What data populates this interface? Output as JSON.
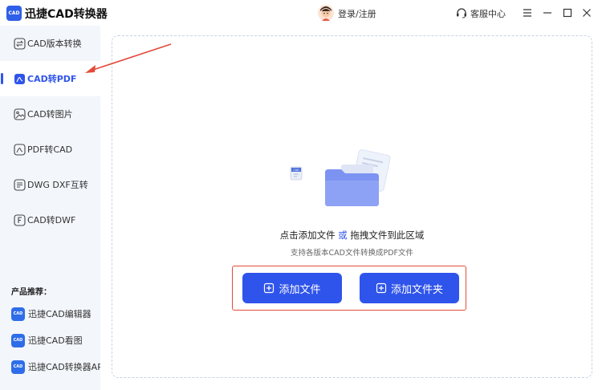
{
  "app": {
    "logo_text": "CAD",
    "title": "迅捷CAD转换器"
  },
  "header": {
    "login": "登录/注册",
    "service": "客服中心"
  },
  "sidebar": {
    "items": [
      {
        "label": "CAD版本转换",
        "icon": "version-convert-icon"
      },
      {
        "label": "CAD转PDF",
        "icon": "pdf-icon",
        "active": true
      },
      {
        "label": "CAD转图片",
        "icon": "image-icon"
      },
      {
        "label": "PDF转CAD",
        "icon": "pdf-to-cad-icon"
      },
      {
        "label": "DWG DXF互转",
        "icon": "dwg-dxf-icon"
      },
      {
        "label": "CAD转DWF",
        "icon": "dwf-icon"
      }
    ],
    "section_title": "产品推荐：",
    "products": [
      {
        "label": "迅捷CAD编辑器",
        "icon_text": "CAD"
      },
      {
        "label": "迅捷CAD看图",
        "icon_text": "CAD"
      },
      {
        "label": "迅捷CAD转换器APP",
        "icon_text": "CAD"
      }
    ]
  },
  "main": {
    "drop_title_a": "点击添加文件",
    "drop_title_or": "或",
    "drop_title_b": "拖拽文件到此区域",
    "drop_sub": "支持各版本CAD文件转换成PDF文件",
    "add_file": "添加文件",
    "add_folder": "添加文件夹",
    "file_badge": "CAD"
  },
  "colors": {
    "accent": "#2f54eb",
    "highlight": "#e34a3a"
  }
}
